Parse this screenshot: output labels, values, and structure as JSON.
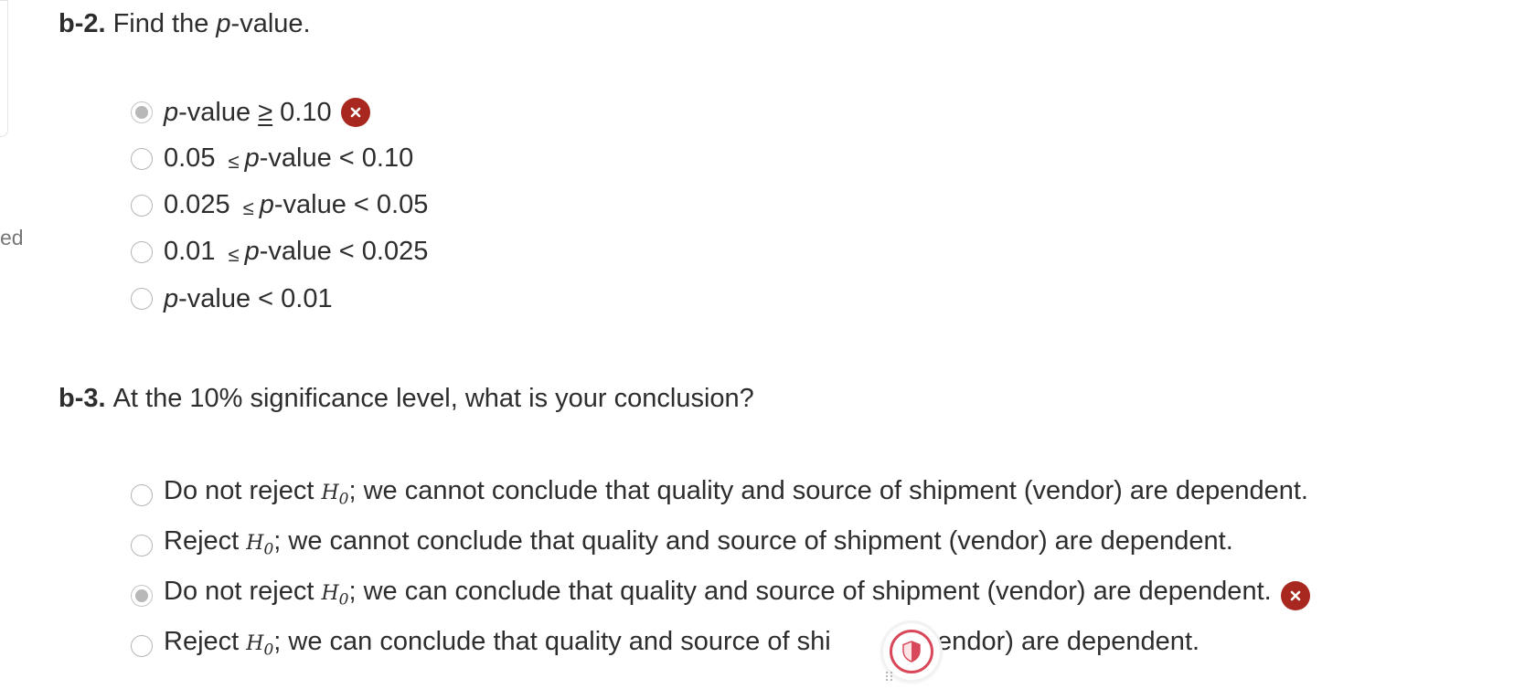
{
  "left_edge": {
    "text": "ed"
  },
  "b2": {
    "number": "b-2.",
    "prompt_before": "Find the ",
    "prompt_var": "p",
    "prompt_after": "-value.",
    "options": [
      {
        "pre": "",
        "var": "p",
        "mid": "-value ",
        "sym": "≥",
        "post": " 0.10",
        "selected": true,
        "mark": "incorrect"
      },
      {
        "pre": "0.05 ",
        "sym": "≤",
        "var": "p",
        "post": "-value < 0.10",
        "selected": false
      },
      {
        "pre": "0.025 ",
        "sym": "≤",
        "var": "p",
        "post": "-value < 0.05",
        "selected": false
      },
      {
        "pre": "0.01 ",
        "sym": "≤",
        "var": "p",
        "post": "-value < 0.025",
        "selected": false
      },
      {
        "pre": "",
        "var": "p",
        "post": "-value < 0.01",
        "selected": false
      }
    ]
  },
  "b3": {
    "number": "b-3.",
    "prompt": "At the 10% significance level, what is your conclusion?",
    "h0_symbol": "H",
    "h0_sub": "0",
    "options": [
      {
        "pre": "Do not reject ",
        "post": "; we cannot conclude that quality and source of shipment (vendor) are dependent.",
        "selected": false
      },
      {
        "pre": "Reject ",
        "post": "; we cannot conclude that quality and source of shipment (vendor) are dependent.",
        "selected": false
      },
      {
        "pre": "Do not reject ",
        "post": "; we can conclude that quality and source of shipment (vendor) are dependent.",
        "selected": true,
        "mark": "incorrect"
      },
      {
        "pre": "Reject ",
        "post_a": "; we can conclude that quality and source of shi",
        "post_b": "nt (vendor) are dependent.",
        "selected": false
      }
    ]
  },
  "overlay": {
    "icon": "shield-icon",
    "accent": "#d9485a"
  },
  "colors": {
    "incorrect": "#a8281f",
    "radio_border": "#b5b5b5",
    "radio_fill": "#b8b8b8"
  }
}
